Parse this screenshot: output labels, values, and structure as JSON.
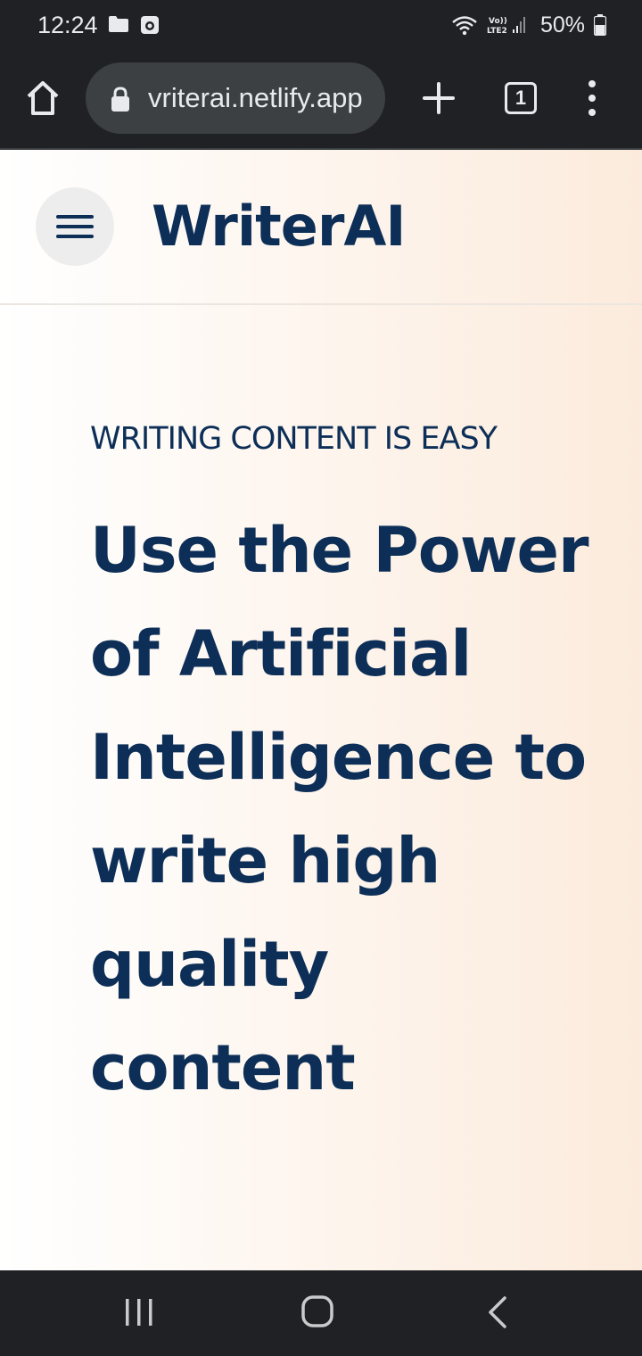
{
  "status_bar": {
    "time": "12:24",
    "network_label": "Vo)) LTE2",
    "battery": "50%"
  },
  "browser": {
    "url": "vriterai.netlify.app",
    "tab_count": "1"
  },
  "site": {
    "brand": "WriterAI",
    "eyebrow": "WRITING CONTENT IS EASY",
    "headline": "Use the Power of Artificial Intelligence to write high quality content"
  },
  "colors": {
    "brand_navy": "#0d2f57",
    "chrome_dark": "#202124",
    "page_bg_start": "#ffffff",
    "page_bg_end": "#fcebdc"
  },
  "icons": {
    "status_left": [
      "folder-icon",
      "camera-app-icon"
    ],
    "status_right": [
      "wifi-icon",
      "signal-icon",
      "battery-icon"
    ],
    "toolbar": [
      "home-icon",
      "lock-icon",
      "plus-icon",
      "tabs-icon",
      "more-vert-icon"
    ],
    "nav": [
      "recents-icon",
      "home-circle-icon",
      "back-icon"
    ]
  }
}
